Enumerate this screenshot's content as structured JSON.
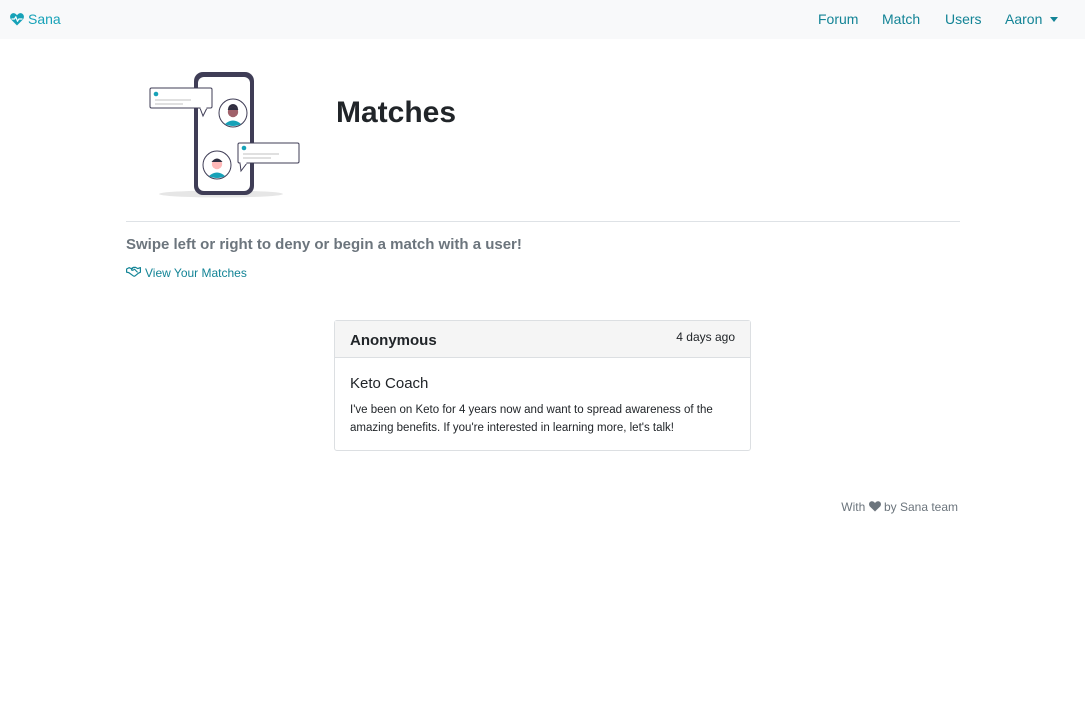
{
  "navbar": {
    "brand": "Sana",
    "links": [
      "Forum",
      "Match",
      "Users"
    ],
    "user_menu": "Aaron"
  },
  "header": {
    "title": "Matches"
  },
  "main": {
    "instructions": "Swipe left or right to deny or begin a match with a user!",
    "view_matches_link": "View Your Matches"
  },
  "card": {
    "author": "Anonymous",
    "time": "4 days ago",
    "title": "Keto Coach",
    "text": "I've been on Keto for 4 years now and want to spread awareness of the amazing benefits. If you're interested in learning more, let's talk!"
  },
  "footer": {
    "prefix": "With",
    "suffix": "by Sana team"
  },
  "icons": {
    "brand": "heartbeat-icon",
    "matches": "handshake-icon",
    "footer": "heart-icon"
  },
  "colors": {
    "accent": "#17a2b8",
    "navbar_bg": "#f8f9fa",
    "muted": "#6c757d"
  }
}
